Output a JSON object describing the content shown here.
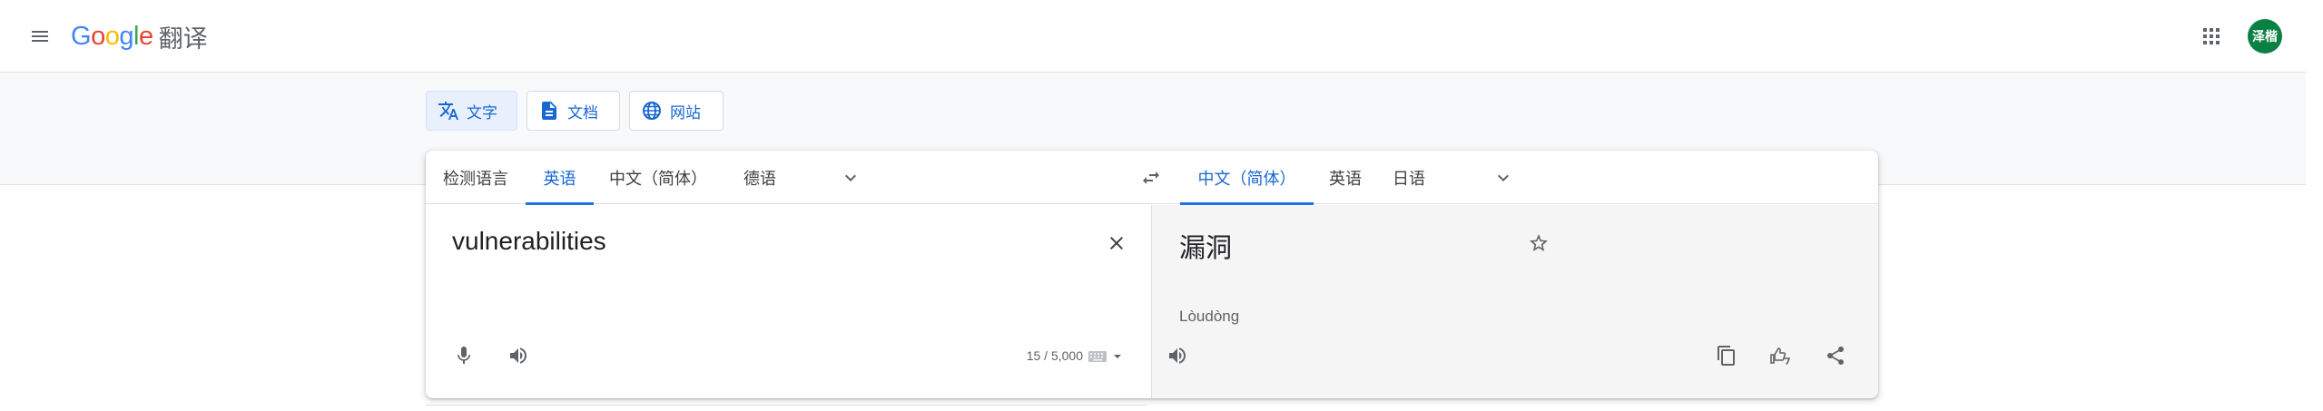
{
  "header": {
    "logo_letters": [
      "G",
      "o",
      "o",
      "g",
      "l",
      "e"
    ],
    "product": "翻译",
    "avatar_initials": "泽楷",
    "icons": {
      "menu": "menu-icon",
      "apps": "apps-grid-icon"
    }
  },
  "modes": [
    {
      "label": "文字",
      "icon": "translate-icon",
      "active": true
    },
    {
      "label": "文档",
      "icon": "document-icon",
      "active": false
    },
    {
      "label": "网站",
      "icon": "globe-icon",
      "active": false
    }
  ],
  "source_langs": [
    {
      "label": "检测语言",
      "active": false
    },
    {
      "label": "英语",
      "active": true
    },
    {
      "label": "中文（简体）",
      "active": false
    },
    {
      "label": "德语",
      "active": false
    }
  ],
  "target_langs": [
    {
      "label": "中文（简体）",
      "active": true
    },
    {
      "label": "英语",
      "active": false
    },
    {
      "label": "日语",
      "active": false
    }
  ],
  "source": {
    "text": "vulnerabilities",
    "char_count": "15 / 5,000"
  },
  "target": {
    "text": "漏洞",
    "romanization": "Lòudòng"
  },
  "colors": {
    "accent": "#1a73e8",
    "active_text": "#1967d2",
    "avatar": "#0b8043",
    "target_bg": "#f5f5f5"
  }
}
